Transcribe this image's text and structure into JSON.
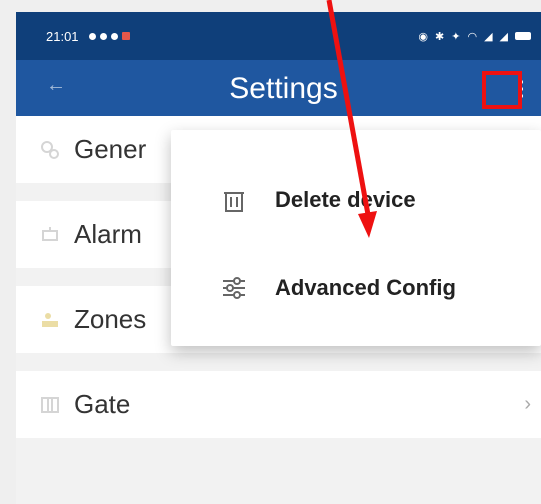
{
  "status": {
    "time": "21:01"
  },
  "appbar": {
    "title": "Settings"
  },
  "menu": {
    "items": [
      {
        "label": "Delete device",
        "icon": "trash-icon"
      },
      {
        "label": "Advanced Config",
        "icon": "sliders-icon"
      }
    ]
  },
  "list": {
    "items": [
      {
        "label": "Gener",
        "icon": "gear-icon",
        "chevron": false
      },
      {
        "label": "Alarm",
        "icon": "alarm-icon",
        "chevron": false
      },
      {
        "label": "Zones",
        "icon": "zones-icon",
        "chevron": true
      },
      {
        "label": "Gate",
        "icon": "gate-icon",
        "chevron": true
      }
    ]
  },
  "colors": {
    "statusbar": "#0f3f7a",
    "appbar": "#1f57a0",
    "annotation": "#e11111"
  }
}
